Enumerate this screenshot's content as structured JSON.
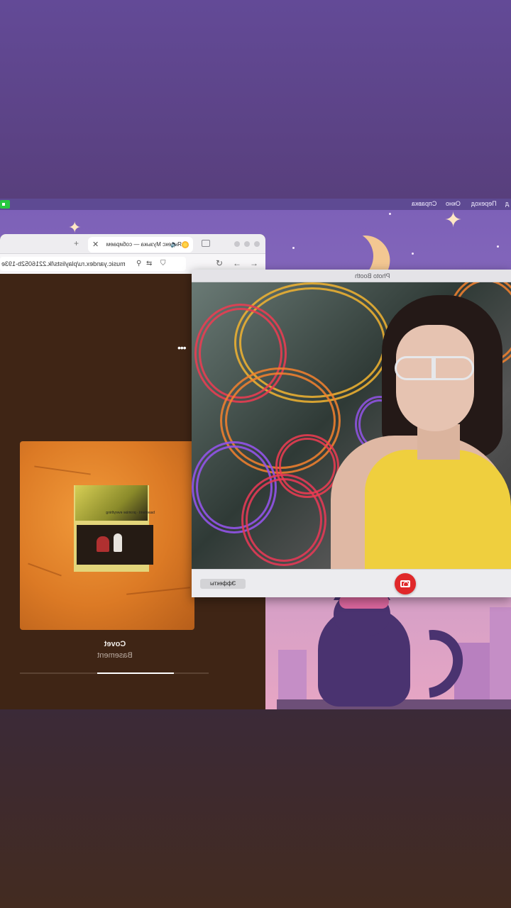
{
  "menubar": {
    "items": [
      "Справка",
      "Окно",
      "Переход",
      "д"
    ]
  },
  "browser": {
    "tab_title": "Яндекс Музыка — собираем",
    "tab_close_icon": "close-icon",
    "url": "music.yandex.ru/playlists/lk.2216052b-193e"
  },
  "player": {
    "track_title": "Covet",
    "artist": "Basement",
    "cover_caption": "basement · promise everything",
    "progress": 0.41
  },
  "photobooth": {
    "title": "Photo Booth",
    "effects_label": "Эффекты"
  },
  "colors": {
    "shutter": "#e0282a",
    "accent_green": "#28c840"
  }
}
